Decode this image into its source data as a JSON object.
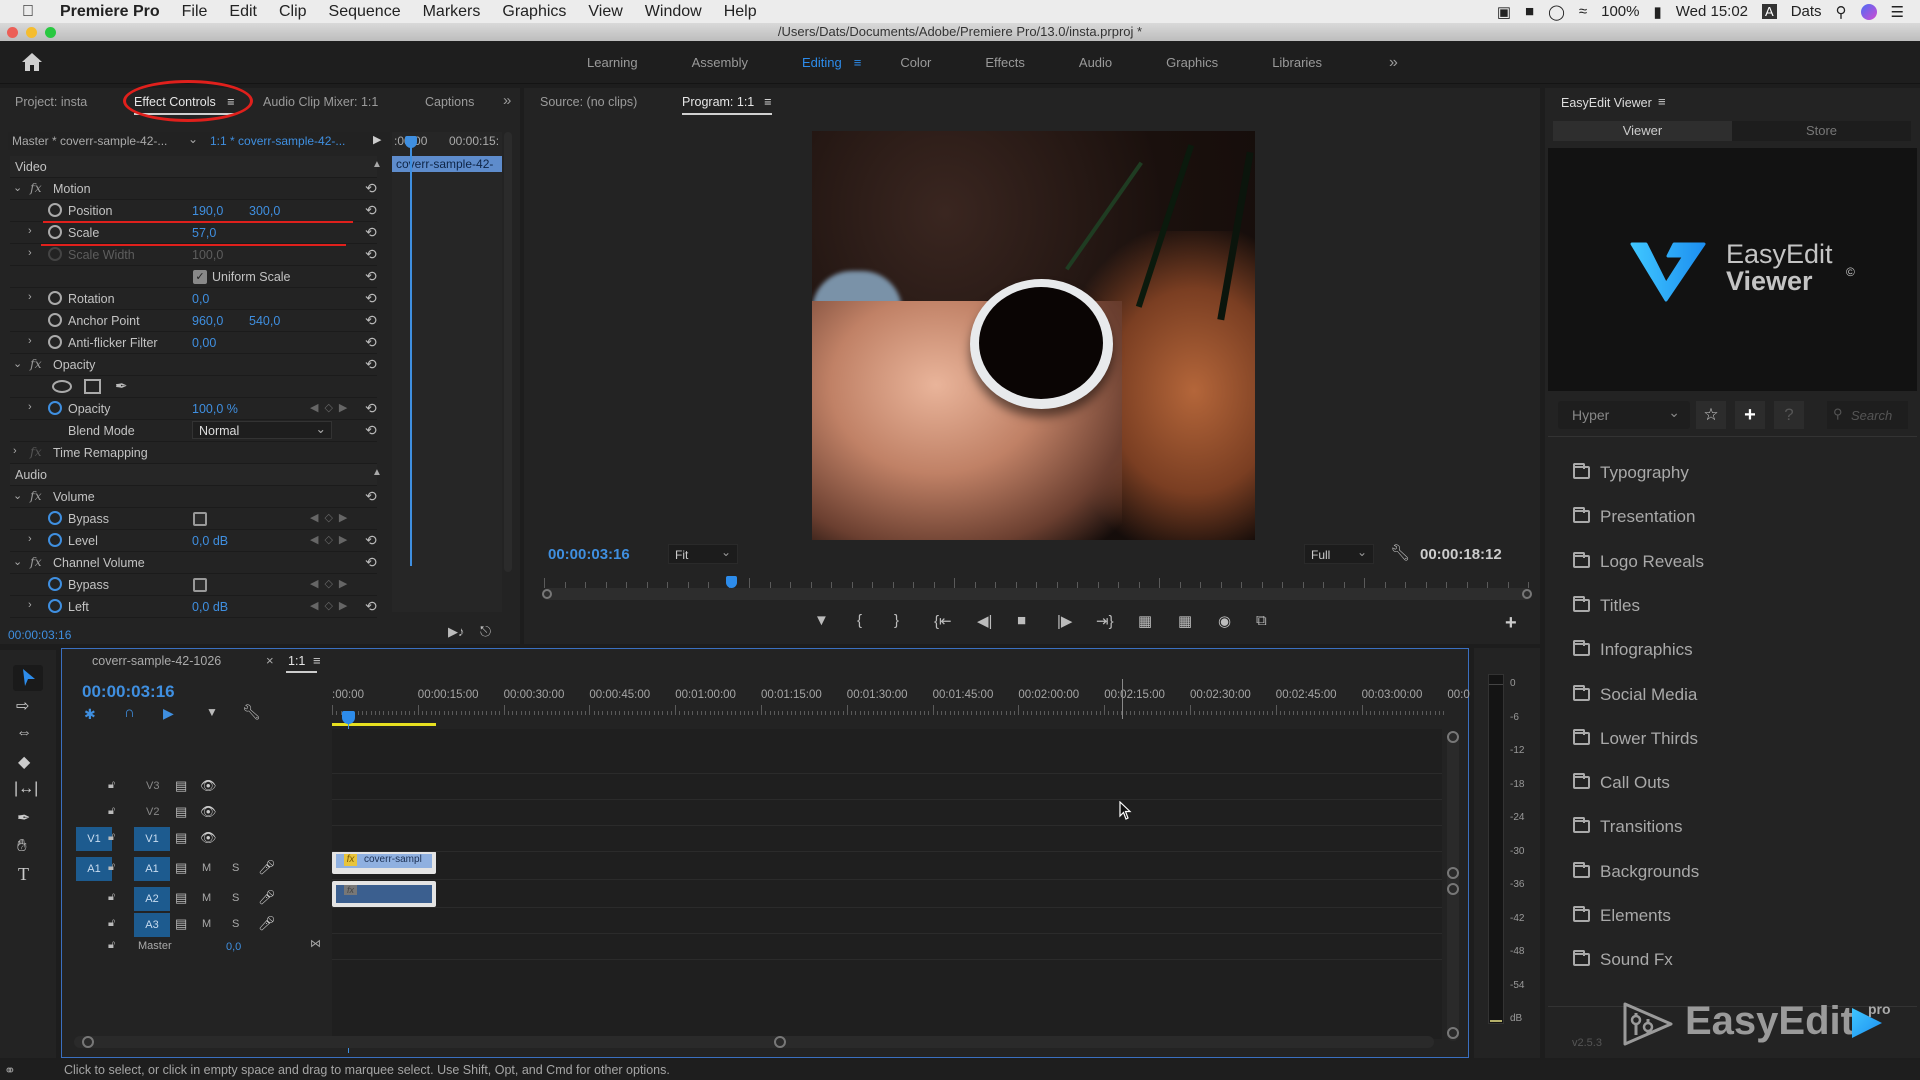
{
  "menubar": {
    "app_name": "Premiere Pro",
    "items": [
      "File",
      "Edit",
      "Clip",
      "Sequence",
      "Markers",
      "Graphics",
      "View",
      "Window",
      "Help"
    ],
    "battery": "100%",
    "clock": "Wed 15:02",
    "input_source": "A",
    "user": "Dats"
  },
  "window": {
    "title": "/Users/Dats/Documents/Adobe/Premiere Pro/13.0/insta.prproj *"
  },
  "workspaces": {
    "tabs": [
      "Learning",
      "Assembly",
      "Editing",
      "Color",
      "Effects",
      "Audio",
      "Graphics",
      "Libraries"
    ],
    "active": "Editing",
    "overflow": "»"
  },
  "left_panel": {
    "tabs": [
      "Project: insta",
      "Effect Controls",
      "Audio Clip Mixer: 1:1",
      "Captions"
    ],
    "active": "Effect Controls",
    "overflow": "»",
    "master_label": "Master * coverr-sample-42-...",
    "clip_label": "1:1 * coverr-sample-42-...",
    "mini_timeline": {
      "start": ":00:00",
      "next": "00:00:15:",
      "clip": "coverr-sample-42-"
    },
    "timecode": "00:00:03:16",
    "video_header": "Video",
    "audio_header": "Audio",
    "motion": "Motion",
    "position": {
      "label": "Position",
      "x": "190,0",
      "y": "300,0"
    },
    "scale": {
      "label": "Scale",
      "value": "57,0"
    },
    "scale_width": {
      "label": "Scale Width",
      "value": "100,0"
    },
    "uniform_scale": {
      "label": "Uniform Scale",
      "checked": true
    },
    "rotation": {
      "label": "Rotation",
      "value": "0,0"
    },
    "anchor": {
      "label": "Anchor Point",
      "x": "960,0",
      "y": "540,0"
    },
    "antiflicker": {
      "label": "Anti-flicker Filter",
      "value": "0,00"
    },
    "opacity_group": "Opacity",
    "opacity": {
      "label": "Opacity",
      "value": "100,0 %"
    },
    "blend": {
      "label": "Blend Mode",
      "value": "Normal"
    },
    "time_remap": "Time Remapping",
    "volume": "Volume",
    "bypass1": {
      "label": "Bypass",
      "checked": false
    },
    "level": {
      "label": "Level",
      "value": "0,0 dB"
    },
    "channel_volume": "Channel Volume",
    "bypass2": {
      "label": "Bypass",
      "checked": false
    },
    "left": {
      "label": "Left",
      "value": "0,0 dB"
    }
  },
  "program": {
    "source_tab": "Source: (no clips)",
    "program_tab": "Program: 1:1",
    "current_tc": "00:00:03:16",
    "zoom": "Fit",
    "quality": "Full",
    "duration_tc": "00:00:18:12",
    "playhead_fraction": 0.19
  },
  "easyedit": {
    "title": "EasyEdit Viewer",
    "tabs": [
      "Viewer",
      "Store"
    ],
    "logo_line1": "EasyEdit",
    "logo_line2": "Viewer",
    "logo_mark": "©",
    "preset": "Hyper",
    "search_placeholder": "Search",
    "help": "?",
    "folders": [
      "Typography",
      "Presentation",
      "Logo Reveals",
      "Titles",
      "Infographics",
      "Social Media",
      "Lower Thirds",
      "Call Outs",
      "Transitions",
      "Backgrounds",
      "Elements",
      "Sound Fx"
    ],
    "version": "v2.5.3",
    "watermark": "EasyEdit",
    "watermark_badge": "pro"
  },
  "timeline": {
    "sequence_tab": "coverr-sample-42-1026",
    "active_tab": "1:1",
    "timecode": "00:00:03:16",
    "ruler": [
      ":00:00",
      "00:00:15:00",
      "00:00:30:00",
      "00:00:45:00",
      "00:01:00:00",
      "00:01:15:00",
      "00:01:30:00",
      "00:01:45:00",
      "00:02:00:00",
      "00:02:15:00",
      "00:02:30:00",
      "00:02:45:00",
      "00:03:00:00",
      "00:0"
    ],
    "video_tracks": [
      {
        "src": "",
        "name": "V3"
      },
      {
        "src": "",
        "name": "V2"
      },
      {
        "src": "V1",
        "name": "V1"
      }
    ],
    "audio_tracks": [
      {
        "src": "A1",
        "name": "A1"
      },
      {
        "src": "",
        "name": "A2"
      },
      {
        "src": "",
        "name": "A3"
      }
    ],
    "mute": "M",
    "solo": "S",
    "master_label": "Master",
    "master_value": "0,0",
    "clip_label": "coverr-sampl"
  },
  "meter": {
    "scale": [
      "0",
      "-6",
      "-12",
      "-18",
      "-24",
      "-30",
      "-36",
      "-42",
      "-48",
      "-54",
      "dB"
    ]
  },
  "status": {
    "text": "Click to select, or click in empty space and drag to marquee select. Use Shift, Opt, and Cmd for other options."
  },
  "colors": {
    "accent": "#2d8ceb",
    "annotation": "#e0201c",
    "track_active": "#1d5b8f"
  }
}
